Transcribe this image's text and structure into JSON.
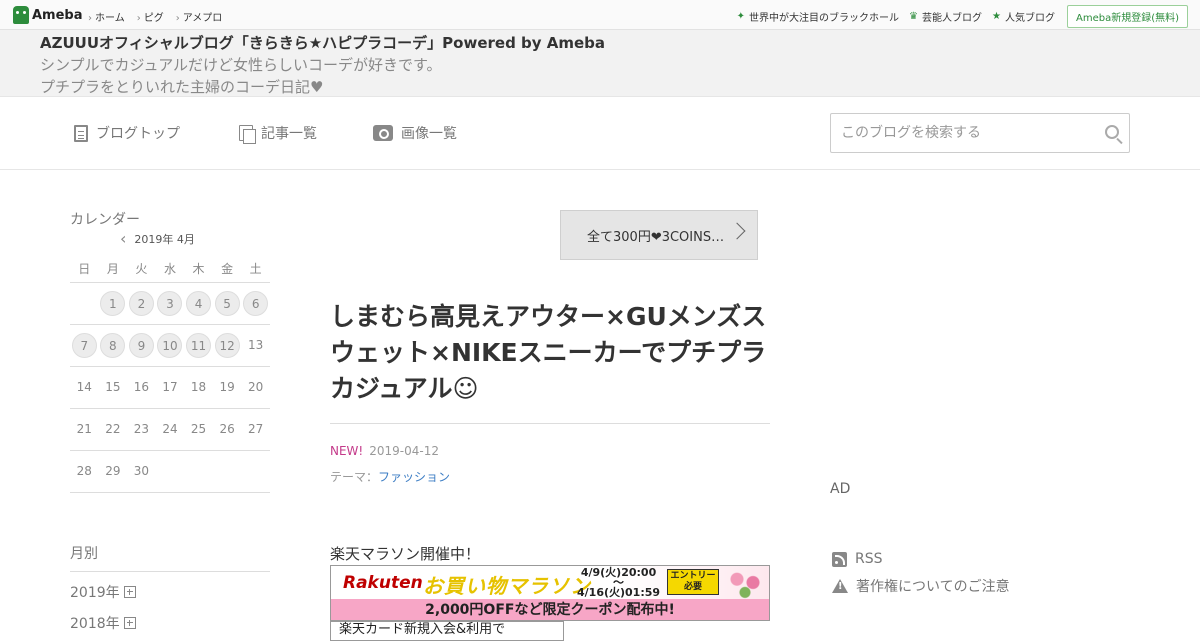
{
  "topbar": {
    "logo": "Ameba",
    "nav": [
      "ホーム",
      "ピグ",
      "アメプロ"
    ],
    "right_links": [
      {
        "label": "世界中が大注目のブラックホール",
        "icon": "sparkle-icon"
      },
      {
        "label": "芸能人ブログ",
        "icon": "crown-icon"
      },
      {
        "label": "人気ブログ",
        "icon": "star-icon"
      }
    ],
    "register": "Ameba新規登録(無料)"
  },
  "blog": {
    "title": "AZUUUオフィシャルブログ「きらきら★ハピプラコーデ」Powered by Ameba",
    "desc1": "シンプルでカジュアルだけど女性らしいコーデが好きです。",
    "desc2": "プチプラをとりいれた主婦のコーデ日記♥"
  },
  "gnav": {
    "top": "ブログトップ",
    "list": "記事一覧",
    "images": "画像一覧",
    "search_placeholder": "このブログを検索する"
  },
  "calendar": {
    "heading": "カレンダー",
    "month": "2019年 4月",
    "weekdays": [
      "日",
      "月",
      "火",
      "水",
      "木",
      "金",
      "土"
    ],
    "weeks": [
      [
        "",
        "1",
        "2",
        "3",
        "4",
        "5",
        "6"
      ],
      [
        "7",
        "8",
        "9",
        "10",
        "11",
        "12",
        "13"
      ],
      [
        "14",
        "15",
        "16",
        "17",
        "18",
        "19",
        "20"
      ],
      [
        "21",
        "22",
        "23",
        "24",
        "25",
        "26",
        "27"
      ],
      [
        "28",
        "29",
        "30",
        "",
        "",
        "",
        ""
      ]
    ],
    "days_with_posts": [
      "1",
      "2",
      "3",
      "4",
      "5",
      "6",
      "7",
      "8",
      "9",
      "10",
      "11",
      "12"
    ]
  },
  "archive": {
    "heading": "月別",
    "years": [
      "2019年",
      "2018年"
    ]
  },
  "next_entry": "全て300円❤3COINS…",
  "entry": {
    "title": "しまむら高見えアウター×GUメンズスウェット×NIKEスニーカーでプチプラカジュアル☺",
    "new_label": "NEW!",
    "date": "2019-04-12",
    "theme_label": "テーマ：",
    "theme": "ファッション",
    "body": "楽天マラソン開催中！",
    "banner": {
      "brand": "Rakuten",
      "campaign": "お買い物マラソン",
      "date_start": "4/9(火)20:00",
      "tilde": "〜",
      "date_end": "4/16(火)01:59",
      "entry_line1": "エントリー",
      "entry_line2": "必要",
      "coupon": "2,000円OFFなど限定クーポン配布中!"
    },
    "card_text": "楽天カード新規入会&利用で"
  },
  "right": {
    "ad": "AD",
    "rss": "RSS",
    "copyright": "著作権についてのご注意"
  },
  "colors": {
    "ameba_green": "#2d8c3c",
    "new_pink": "#c43a8a",
    "link_blue": "#3c7dc4",
    "rakuten_red": "#bf0000"
  }
}
